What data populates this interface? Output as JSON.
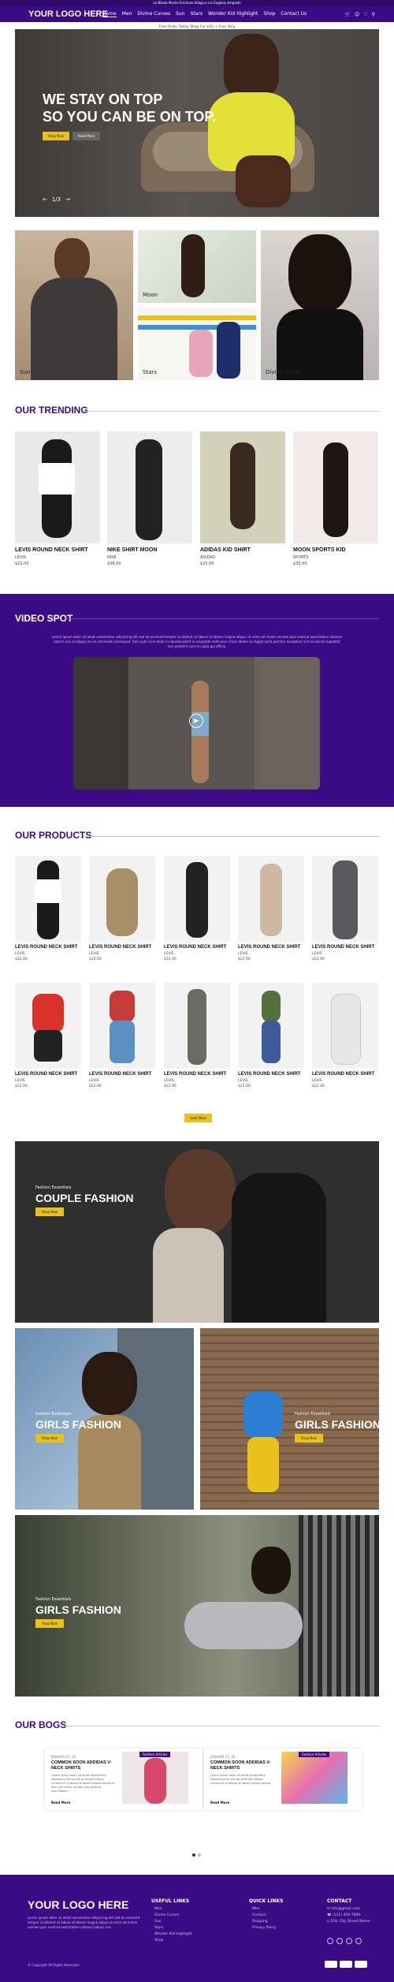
{
  "topbar": {
    "text": "Lo Nikole Moste Grantsas Hilagrus Lin Eogelas Amgleds"
  },
  "nav": {
    "logo": "YOUR LOGO HERE",
    "menu": [
      "Home",
      "Men",
      "Divine Curves",
      "Sun",
      "Stars",
      "Wonder Kid Highlight",
      "Shop",
      "Contact Us"
    ],
    "icons": [
      "cart-icon",
      "user-icon",
      "heart-icon",
      "search-icon"
    ]
  },
  "shipping_note": "Free Order Today Shop For $50 + Free Ship",
  "hero": {
    "title_line1": "WE STAY ON TOP",
    "title_line2": "SO YOU CAN BE ON TOP.",
    "btn_primary": "Shop Now",
    "btn_secondary": "Read More",
    "slide_counter": "1/3"
  },
  "categories": {
    "sun": "Sun",
    "moon": "Moon",
    "stars": "Stars",
    "divine": "Divine Curve"
  },
  "trending": {
    "title": "OUR TRENDING",
    "items": [
      {
        "name": "LEVIS ROUND NECK SHIRT",
        "brand": "LEVIS",
        "price": "$22.00"
      },
      {
        "name": "NIKE SHIRT MOON",
        "brand": "NIKE",
        "price": "$38.00"
      },
      {
        "name": "ADIDAS KID SHIRT",
        "brand": "ADIDAS",
        "price": "$25.00"
      },
      {
        "name": "MOON SPORTS KID",
        "brand": "SPORTS",
        "price": "$35.00"
      }
    ]
  },
  "video": {
    "title": "VIDEO SPOT",
    "text": "Lorem ipsum dolor sit amet consectetur adipiscing elit sed do eiusmod tempor incididunt ut labore et dolore magna aliqua. Ut enim ad minim veniam quis nostrud exercitation ullamco laboris nisi ut aliquip ex ea commodo consequat. Duis aute irure dolor in reprehenderit in voluptate velit esse cillum dolore eu fugiat nulla pariatur excepteur sint occaecat cupidatat non proident sunt in culpa qui officia."
  },
  "products": {
    "title": "OUR PRODUCTS",
    "items": [
      {
        "name": "LEVIS ROUND NECK SHIRT",
        "brand": "LEVIS",
        "price": "$22.00"
      },
      {
        "name": "LEVIS ROUND NECK SHIRT",
        "brand": "LEVIS",
        "price": "$22.00"
      },
      {
        "name": "LEVIS ROUND NECK SHIRT",
        "brand": "LEVIS",
        "price": "$22.00"
      },
      {
        "name": "LEVIS ROUND NECK SHIRT",
        "brand": "LEVIS",
        "price": "$22.00"
      },
      {
        "name": "LEVIS ROUND NECK SHIRT",
        "brand": "LEVIS",
        "price": "$22.00"
      },
      {
        "name": "LEVIS ROUND NECK SHIRT",
        "brand": "LEVIS",
        "price": "$22.00"
      },
      {
        "name": "LEVIS ROUND NECK SHIRT",
        "brand": "LEVIS",
        "price": "$22.00"
      },
      {
        "name": "LEVIS ROUND NECK SHIRT",
        "brand": "LEVIS",
        "price": "$22.00"
      },
      {
        "name": "LEVIS ROUND NECK SHIRT",
        "brand": "LEVIS",
        "price": "$22.00"
      },
      {
        "name": "LEVIS ROUND NECK SHIRT",
        "brand": "LEVIS",
        "price": "$22.00"
      }
    ],
    "load_more": "Load More"
  },
  "banners": {
    "couple": {
      "sub": "Fashion Essentials",
      "title": "COUPLE FASHION",
      "btn": "Shop Now"
    },
    "girls1": {
      "sub": "Fashion Essentials",
      "title": "GIRLS FASHION",
      "btn": "Shop Now"
    },
    "girls2": {
      "sub": "Fashion Essentials",
      "title": "GIRLS FASHION",
      "btn": "Shop Now"
    },
    "girls3": {
      "sub": "Fashion Essentials",
      "title": "GIRLS FASHION",
      "btn": "Shop Now"
    }
  },
  "blogs": {
    "title": "OUR BOGS",
    "items": [
      {
        "date": "JANUARY 27, 20",
        "title": "COMMON SOON ADDIDAS V-NECK SHIRTS",
        "excerpt": "Lorem ipsum dolor sit amet consectetur adipiscing elit sed do eiusmod tempor incididunt ut labore et dolore magna aliqua ut enim ad minim veniam quis nostrud exercitation.",
        "read": "Read More",
        "tag": "Fashion Articles"
      },
      {
        "date": "JANUARY 27, 20",
        "title": "COMMON SOON ADDIDAS V-NECK SHIRTS",
        "excerpt": "Lorem ipsum dolor sit amet consectetur adipiscing elit sed do eiusmod tempor incididunt ut labore et dolore magna aliqua.",
        "read": "Read More",
        "tag": "Fashion Articles"
      }
    ]
  },
  "footer": {
    "logo": "YOUR LOGO HERE",
    "about": "Lorem ipsum dolor sit amet consectetur adipiscing elit sed do eiusmod tempor incididunt ut labore et dolore magna aliqua ut enim ad minim veniam quis nostrud exercitation ullamco laboris nisi.",
    "useful_title": "USEFUL LINKS",
    "useful": [
      "Men",
      "Divine Curves",
      "Sun",
      "Stars",
      "Wonder Kid Highlight",
      "Shop"
    ],
    "quick_title": "QUICK LINKS",
    "quick": [
      "Men",
      "Contact",
      "Shipping",
      "Privacy Policy"
    ],
    "contact_title": "CONTACT",
    "contact": [
      "info@gmail.com",
      "(123) 456-7890",
      "100, City Street Name"
    ],
    "copyright": "© Copyright All Rights Reserved"
  }
}
